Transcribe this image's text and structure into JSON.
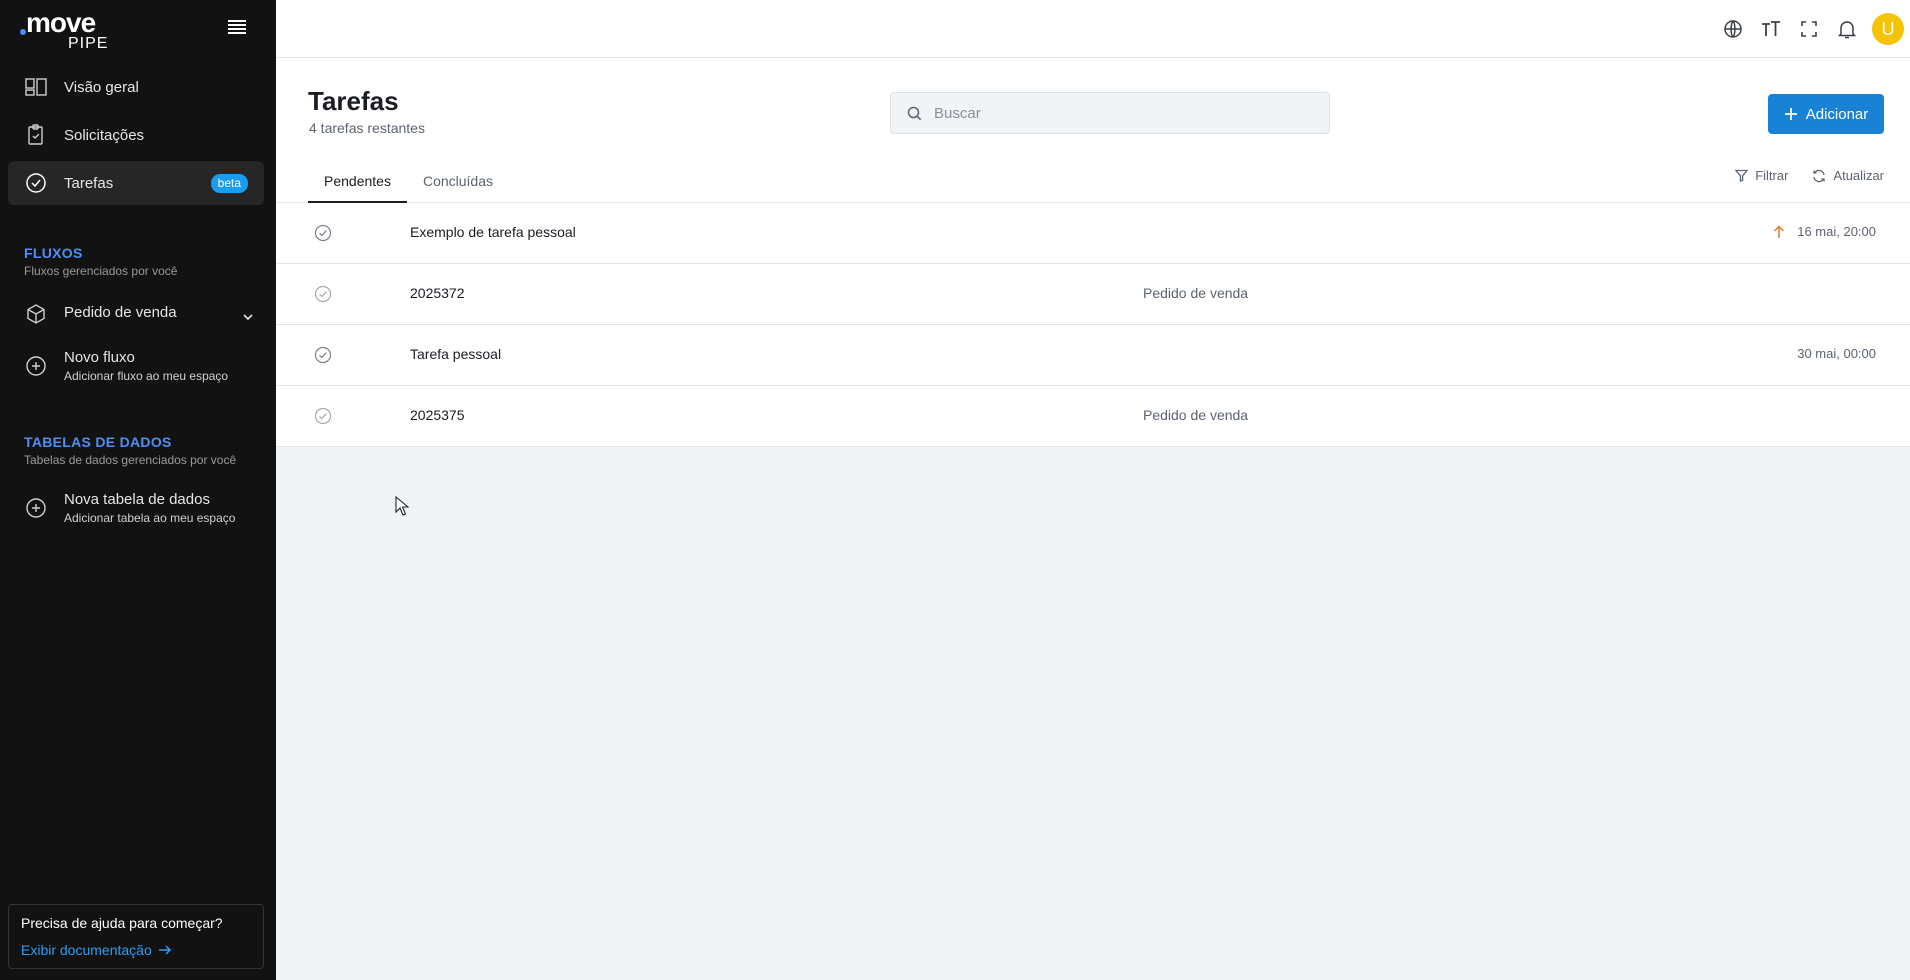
{
  "sidebar": {
    "logo": {
      "brand": "move",
      "sub": "PIPE"
    },
    "nav": [
      {
        "label": "Visão geral",
        "icon": "dashboard-icon"
      },
      {
        "label": "Solicitações",
        "icon": "clipboard-icon"
      },
      {
        "label": "Tarefas",
        "icon": "check-circle-icon",
        "badge": "beta",
        "active": true
      }
    ],
    "flows_section": {
      "title": "FLUXOS",
      "subtitle": "Fluxos gerenciados por você"
    },
    "flows": [
      {
        "title": "Pedido de venda",
        "icon": "cube-icon"
      },
      {
        "title": "Novo fluxo",
        "subtitle": "Adicionar fluxo ao meu espaço",
        "icon": "plus-circle-icon"
      }
    ],
    "tables_section": {
      "title": "TABELAS DE DADOS",
      "subtitle": "Tabelas de dados gerenciados por você"
    },
    "tables": [
      {
        "title": "Nova tabela de dados",
        "subtitle": "Adicionar tabela ao meu espaço",
        "icon": "plus-circle-icon"
      }
    ],
    "help": {
      "question": "Precisa de ajuda para começar?",
      "link": "Exibir documentação"
    }
  },
  "topbar": {
    "icons": [
      "globe-icon",
      "text-size-icon",
      "fullscreen-icon",
      "bell-icon"
    ],
    "avatar_initial": "U",
    "avatar_color": "#f5c400"
  },
  "page": {
    "title": "Tarefas",
    "subtitle": "4 tarefas restantes",
    "search_placeholder": "Buscar",
    "add_label": "Adicionar",
    "tabs": [
      "Pendentes",
      "Concluídas"
    ],
    "active_tab": "Pendentes",
    "filter_label": "Filtrar",
    "refresh_label": "Atualizar"
  },
  "tasks": [
    {
      "name": "Exemplo de tarefa pessoal",
      "flow": "",
      "due": "16 mai, 20:00",
      "priority_icon": "arrow-up-icon"
    },
    {
      "name": "2025372",
      "flow": "Pedido de venda",
      "due": ""
    },
    {
      "name": "Tarefa pessoal",
      "flow": "",
      "due": "30 mai, 00:00"
    },
    {
      "name": "2025375",
      "flow": "Pedido de venda",
      "due": ""
    }
  ],
  "colors": {
    "sidebar_bg": "#121212",
    "accent_blue": "#1a82d4",
    "section_title": "#4f8ff7",
    "badge": "#1a9cf0",
    "priority_orange": "#e07a2e"
  }
}
